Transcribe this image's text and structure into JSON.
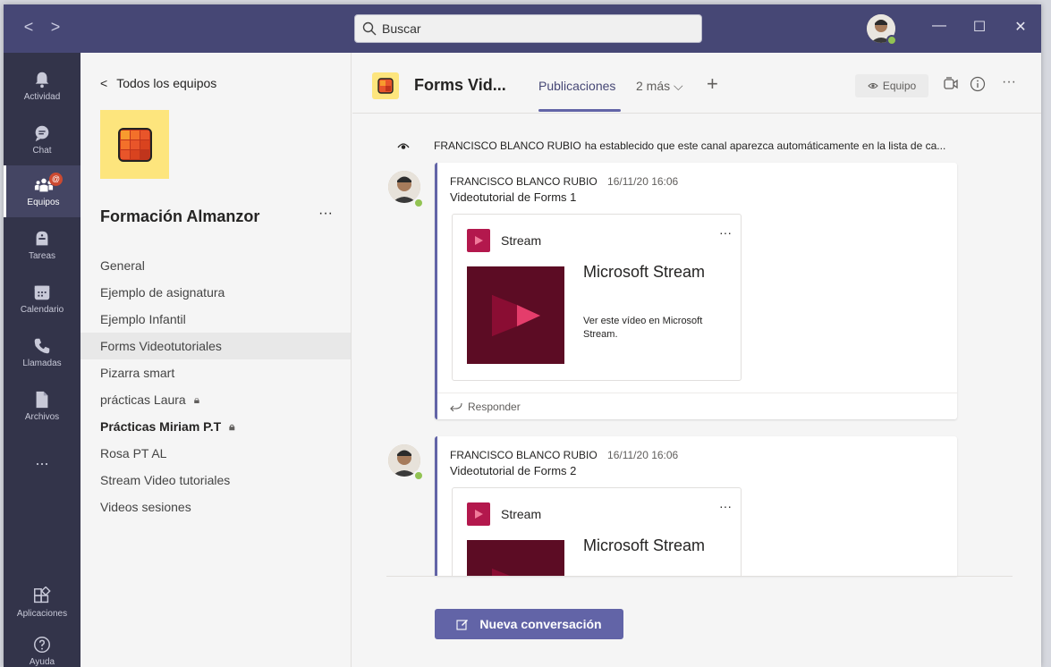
{
  "titlebar": {
    "back_arrow": "<",
    "forward_arrow": ">",
    "search_placeholder": "Buscar",
    "minimize": "—",
    "maximize": "☐",
    "close": "✕"
  },
  "rail": {
    "items": [
      {
        "label": "Actividad",
        "icon": "bell-icon"
      },
      {
        "label": "Chat",
        "icon": "chat-icon"
      },
      {
        "label": "Equipos",
        "icon": "teams-icon",
        "badge": "@"
      },
      {
        "label": "Tareas",
        "icon": "tasks-icon"
      },
      {
        "label": "Calendario",
        "icon": "calendar-icon"
      },
      {
        "label": "Llamadas",
        "icon": "phone-icon"
      },
      {
        "label": "Archivos",
        "icon": "file-icon"
      },
      {
        "label": "...",
        "icon": "more-icon"
      },
      {
        "label": "Aplicaciones",
        "icon": "apps-icon"
      },
      {
        "label": "Ayuda",
        "icon": "help-icon"
      }
    ]
  },
  "left_panel": {
    "back_label": "Todos los equipos",
    "back_chevron": "<",
    "team_name": "Formación Almanzor",
    "team_more": "···",
    "lock_glyph": "🔒︎",
    "channels": [
      {
        "name": "General"
      },
      {
        "name": "Ejemplo de asignatura"
      },
      {
        "name": "Ejemplo Infantil"
      },
      {
        "name": "Forms Videotutoriales",
        "active": true
      },
      {
        "name": "Pizarra smart"
      },
      {
        "name": "prácticas Laura",
        "locked": true
      },
      {
        "name": "Prácticas Miriam P.T",
        "locked": true,
        "bold": true
      },
      {
        "name": "Rosa PT AL"
      },
      {
        "name": "Stream Video tutoriales"
      },
      {
        "name": "Videos sesiones"
      }
    ]
  },
  "header": {
    "channel_title": "Forms Vid...",
    "tab_active": "Publicaciones",
    "tab_more": "2 más",
    "tab_more_chevron": "⌵",
    "tab_add": "+",
    "equipo_label": "Equipo",
    "more": "···"
  },
  "feed": {
    "info_author": "FRANCISCO BLANCO RUBIO",
    "info_text": "ha establecido que este canal aparezca automáticamente en la lista de ca...",
    "posts": [
      {
        "author": "FRANCISCO BLANCO RUBIO",
        "time": "16/11/20 16:06",
        "text": "Videotutorial de Forms 1",
        "card_app": "Stream",
        "card_title": "Microsoft Stream",
        "card_desc": "Ver este vídeo en Microsoft Stream.",
        "card_more": "···",
        "reply": "Responder"
      },
      {
        "author": "FRANCISCO BLANCO RUBIO",
        "time": "16/11/20 16:06",
        "text": "Videotutorial de Forms 2",
        "card_app": "Stream",
        "card_title": "Microsoft Stream",
        "card_more": "···"
      }
    ]
  },
  "new_conversation_label": "Nueva conversación",
  "colors": {
    "titlebar": "#464775",
    "rail": "#33344a",
    "accent": "#6264a7",
    "stream": "#b3184d"
  }
}
